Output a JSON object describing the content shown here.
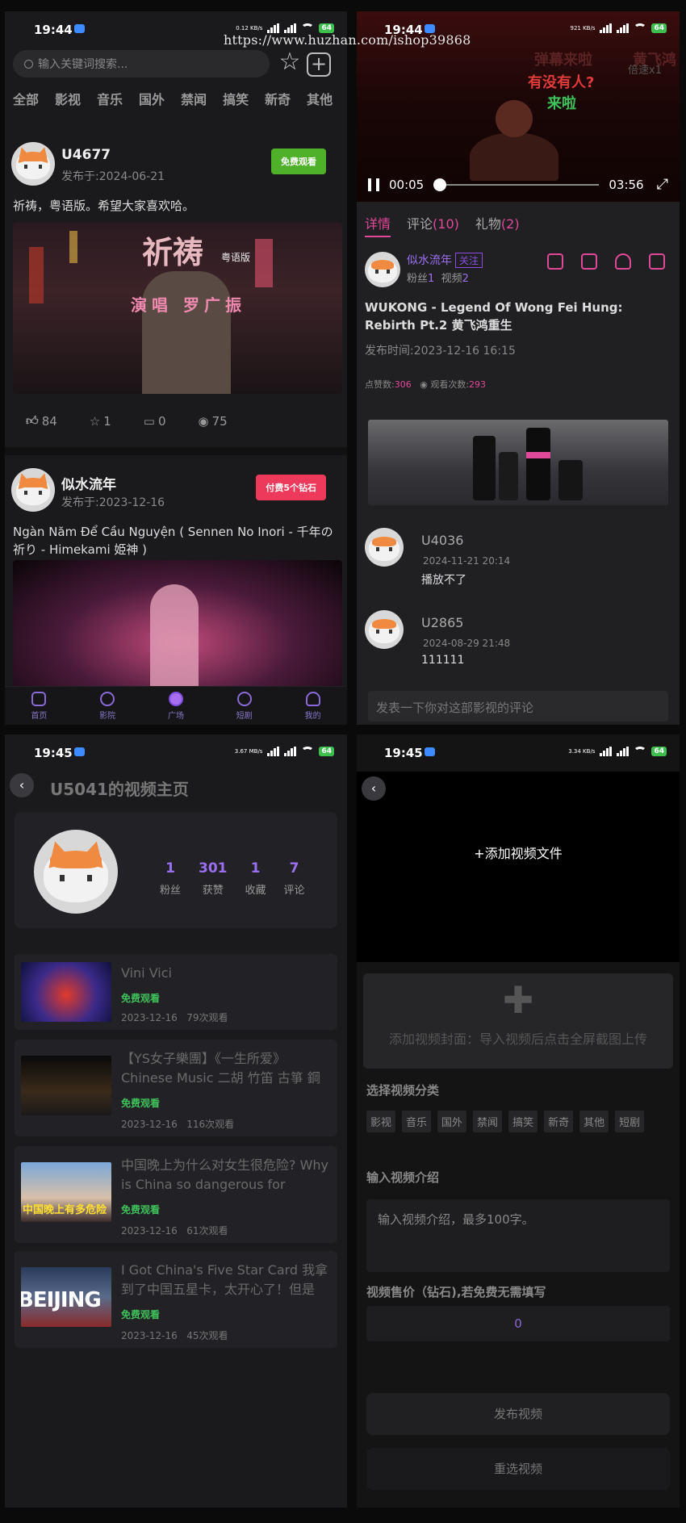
{
  "watermark": "https://www.huzhan.com/ishop39868",
  "square": {
    "status": {
      "time": "19:44",
      "speed": "0.12 KB/s",
      "battery": "64"
    },
    "search_placeholder": "输入关键词搜索...",
    "categories": [
      "全部",
      "影视",
      "音乐",
      "国外",
      "禁闻",
      "搞笑",
      "新奇",
      "其他"
    ],
    "posts": [
      {
        "user": "U4677",
        "date": "发布于:2024-06-21",
        "badge": "免费观看",
        "text": "祈祷，粤语版。希望大家喜欢哈。",
        "image_title": "祈祷",
        "image_tag": "粤语版",
        "image_sub": "演唱 罗广振",
        "likes": "84",
        "stars": "1",
        "comments": "0",
        "views": "75"
      },
      {
        "user": "似水流年",
        "date": "发布于:2023-12-16",
        "badge": "付费5个钻石",
        "text": "Ngàn Năm Để Cầu Nguyện ( Sennen No Inori - 千年の祈り - Himekami 姫神 )"
      }
    ],
    "tabs": [
      "首页",
      "影院",
      "广场",
      "短剧",
      "我的"
    ]
  },
  "player": {
    "status": {
      "time": "19:44",
      "speed": "921 KB/s",
      "battery": "64"
    },
    "danmaku": [
      "弹幕来啦",
      "黄飞鸿",
      "有没有人?",
      "来啦"
    ],
    "speed_label": "倍速x1",
    "time_current": "00:05",
    "time_total": "03:56",
    "tabs": {
      "detail": "详情",
      "comments": "评论",
      "comments_count": "(10)",
      "gifts": "礼物",
      "gifts_count": "(2)"
    },
    "author": {
      "name": "似水流年",
      "follow": "关注",
      "fans_label": "粉丝",
      "fans": "1",
      "videos_label": "视频",
      "videos": "2"
    },
    "title": "WUKONG - Legend Of Wong Fei Hung: Rebirth Pt.2 黄飞鸿重生",
    "publish_time": "发布时间:2023-12-16 16:15",
    "likes_label": "点赞数:",
    "likes": "306",
    "views_label": "观看次数:",
    "views": "293",
    "comments": [
      {
        "user": "U4036",
        "date": "2024-11-21 20:14",
        "text": "播放不了"
      },
      {
        "user": "U2865",
        "date": "2024-08-29 21:48",
        "text": "111111"
      }
    ],
    "comment_placeholder": "发表一下你对这部影视的评论"
  },
  "profile": {
    "status": {
      "time": "19:45",
      "speed": "3.67 MB/s",
      "battery": "64"
    },
    "title": "U5041的视频主页",
    "stats": [
      {
        "value": "1",
        "label": "粉丝"
      },
      {
        "value": "301",
        "label": "获赞"
      },
      {
        "value": "1",
        "label": "收藏"
      },
      {
        "value": "7",
        "label": "评论"
      }
    ],
    "videos": [
      {
        "title": "Vini Vici",
        "free": "免费观看",
        "date": "2023-12-16",
        "views": "79次观看"
      },
      {
        "title": "【YS女子樂團】《一生所爱》Chinese Music 二胡 竹笛 古箏 鋼琴",
        "free": "免费观看",
        "date": "2023-12-16",
        "views": "116次观看"
      },
      {
        "title": "中国晚上为什么对女生很危险? Why is China so dangerous for women",
        "free": "免费观看",
        "date": "2023-12-16",
        "views": "61次观看",
        "thumb_text": "中国晚上有多危险"
      },
      {
        "title": "I Got China's Five Star Card 我拿到了中国五星卡，太开心了！但是",
        "free": "免费观看",
        "date": "2023-12-16",
        "views": "45次观看",
        "thumb_text": "BEIJING"
      }
    ]
  },
  "upload": {
    "status": {
      "time": "19:45",
      "speed": "3.34 KB/s",
      "battery": "64"
    },
    "add_video": "+添加视频文件",
    "cover_text": "添加视频封面：导入视频后点击全屏截图上传",
    "category_label": "选择视频分类",
    "categories": [
      "影视",
      "音乐",
      "国外",
      "禁闻",
      "搞笑",
      "新奇",
      "其他",
      "短剧"
    ],
    "intro_label": "输入视频介绍",
    "intro_placeholder": "输入视频介绍，最多100字。",
    "price_label": "视频售价（钻石),若免费无需填写",
    "price_value": "0",
    "publish": "发布视频",
    "reselect": "重选视频"
  },
  "colors": {
    "accent_pink": "#e0489a",
    "accent_purple": "#9a70f0",
    "free_green": "#3fc25a",
    "badge_green": "#4fb02a",
    "badge_red": "#ee3a5a"
  }
}
